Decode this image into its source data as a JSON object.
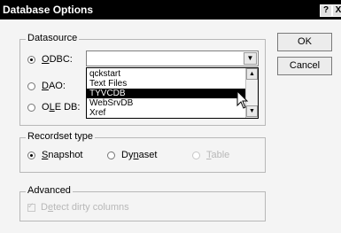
{
  "window": {
    "title": "Database Options",
    "help_label": "?",
    "close_label": "X"
  },
  "datasource": {
    "group_label": "Datasource",
    "odbc": {
      "accel": "O",
      "rest": "DBC:",
      "selected": true
    },
    "dao": {
      "accel": "D",
      "rest": "AO:",
      "selected": false
    },
    "oledb": {
      "pre": "O",
      "accel": "L",
      "rest": "E DB:",
      "selected": false
    },
    "combo_value": "",
    "dropdown_items": [
      "qckstart",
      "Text Files",
      "TYVCDB",
      "WebSrvDB",
      "Xref"
    ],
    "highlighted_item": "TYVCDB"
  },
  "recordset": {
    "group_label": "Recordset type",
    "snapshot": {
      "accel": "S",
      "rest": "napshot",
      "selected": true
    },
    "dynaset": {
      "pre": "Dy",
      "accel": "n",
      "rest": "aset",
      "selected": false
    },
    "table": {
      "accel": "T",
      "rest": "able",
      "selected": false,
      "enabled": false
    }
  },
  "advanced": {
    "group_label": "Advanced",
    "detect_dirty": {
      "pre": "D",
      "accel": "e",
      "rest": "tect dirty columns",
      "checked": true,
      "enabled": false
    }
  },
  "buttons": {
    "ok": "OK",
    "cancel": "Cancel"
  },
  "icons": {
    "combo_arrow": "chevron-down-icon",
    "scroll_up": "scroll-up-icon",
    "scroll_down": "scroll-down-icon",
    "cursor": "arrow-pointer-icon"
  }
}
